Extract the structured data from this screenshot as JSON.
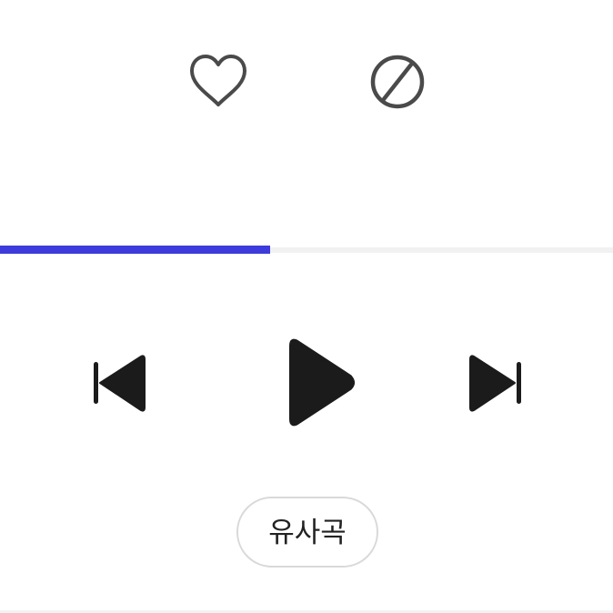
{
  "player": {
    "progress_fraction": 0.44,
    "colors": {
      "progress_fill": "#3d3bdc",
      "progress_track": "#f1f1f1",
      "icon_outline": "#4a4a4a",
      "control": "#1b1b1b"
    },
    "actions": {
      "like_icon": "heart-outline-icon",
      "block_icon": "block-icon"
    },
    "controls": {
      "prev_icon": "skip-previous-icon",
      "play_icon": "play-icon",
      "next_icon": "skip-next-icon"
    },
    "similar_button_label": "유사곡"
  }
}
